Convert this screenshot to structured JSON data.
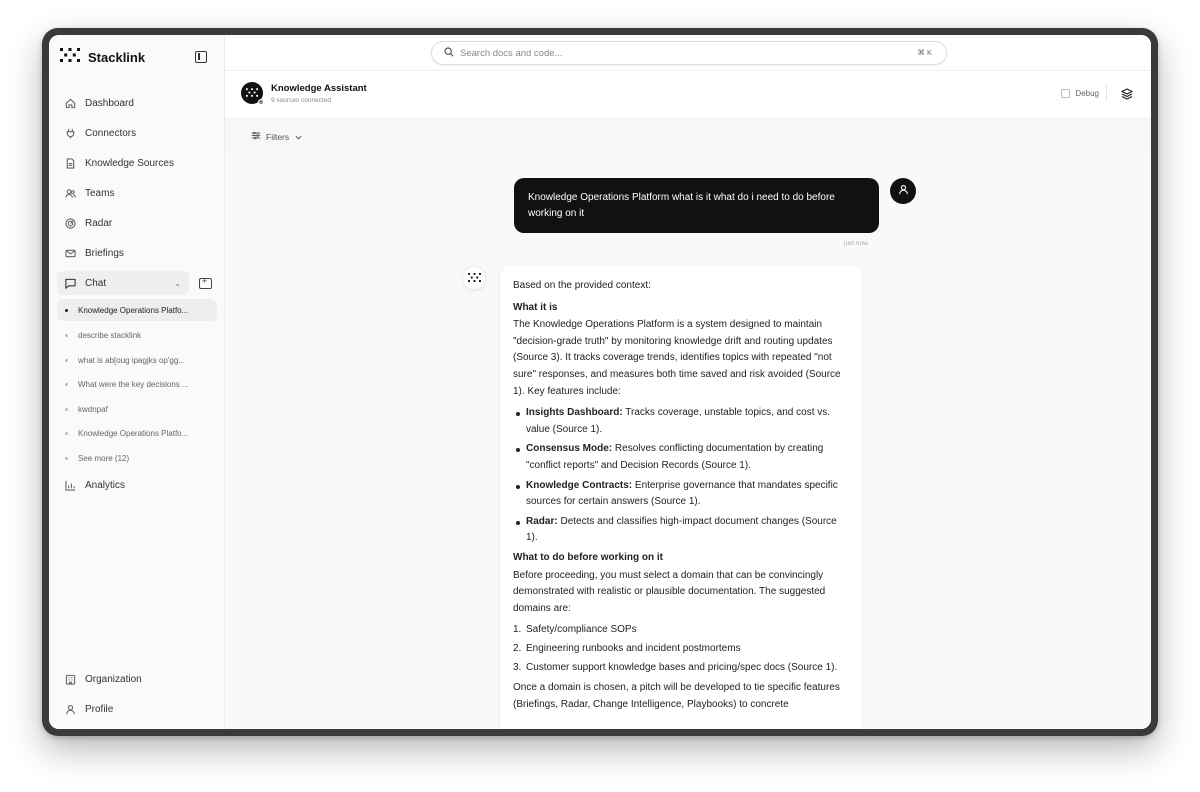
{
  "brand": {
    "name": "Stacklink"
  },
  "sidebar": {
    "items": [
      {
        "label": "Dashboard"
      },
      {
        "label": "Connectors"
      },
      {
        "label": "Knowledge Sources"
      },
      {
        "label": "Teams"
      },
      {
        "label": "Radar"
      },
      {
        "label": "Briefings"
      }
    ],
    "chat": {
      "label": "Chat",
      "threads": [
        "Knowledge Operations Platfo...",
        "describe stacklink",
        "what is ab[oug ipagjks op'gg...",
        "What were the key decisions ...",
        "kwdnpaf",
        "Knowledge Operations Platfo..."
      ],
      "see_more": "See more (12)"
    },
    "analytics": "Analytics",
    "organization": "Organization",
    "profile": "Profile"
  },
  "search": {
    "placeholder": "Search docs and code...",
    "shortcut": "⌘ K"
  },
  "header": {
    "agent_name": "Knowledge Assistant",
    "agent_status": "9 sources connected",
    "debug_label": "Debug"
  },
  "filters": {
    "label": "Filters"
  },
  "conversation": {
    "user_message": "Knowledge Operations Platform what is it what do i need to do before working on it",
    "timestamp": "just now",
    "reply": {
      "intro": "Based on the provided context:",
      "section1_title": "What it is",
      "section1_text": "The Knowledge Operations Platform is a system designed to maintain \"decision-grade truth\" by monitoring knowledge drift and routing updates (Source 3). It tracks coverage trends, identifies topics with repeated \"not sure\" responses, and measures both time saved and risk avoided (Source 1). Key features include:",
      "features": [
        {
          "name": "Insights Dashboard:",
          "desc": "Tracks coverage, unstable topics, and cost vs. value (Source 1)."
        },
        {
          "name": "Consensus Mode:",
          "desc": "Resolves conflicting documentation by creating \"conflict reports\" and Decision Records (Source 1)."
        },
        {
          "name": "Knowledge Contracts:",
          "desc": "Enterprise governance that mandates specific sources for certain answers (Source 1)."
        },
        {
          "name": "Radar:",
          "desc": "Detects and classifies high-impact document changes (Source 1)."
        }
      ],
      "section2_title": "What to do before working on it",
      "section2_text": "Before proceeding, you must select a domain that can be convincingly demonstrated with realistic or plausible documentation. The suggested domains are:",
      "domains": [
        {
          "num": "1.",
          "text": "Safety/compliance SOPs"
        },
        {
          "num": "2.",
          "text": "Engineering runbooks and incident postmortems"
        },
        {
          "num": "3.",
          "text": "Customer support knowledge bases and pricing/spec docs (Source 1)."
        }
      ],
      "closing": "Once a domain is chosen, a pitch will be developed to tie specific features (Briefings, Radar, Change Intelligence, Playbooks) to concrete"
    }
  }
}
